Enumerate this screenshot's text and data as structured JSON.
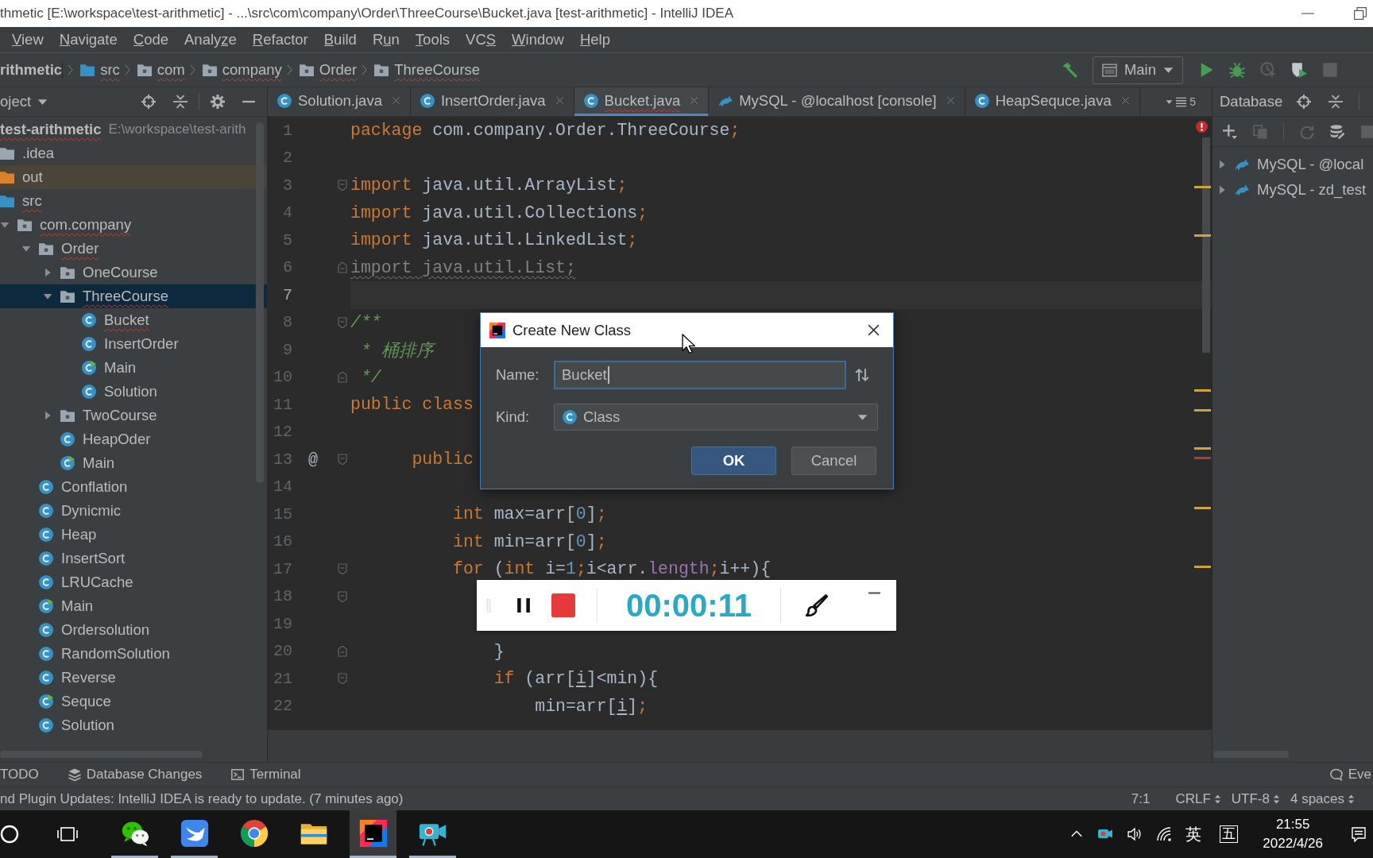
{
  "window": {
    "title": "thmetic [E:\\workspace\\test-arithmetic] - ...\\src\\com\\company\\Order\\ThreeCourse\\Bucket.java [test-arithmetic] - IntelliJ IDEA"
  },
  "menu": [
    {
      "label": "View",
      "mnemonic": {
        "kind": "first"
      }
    },
    {
      "label": "Navigate",
      "mnemonic": {
        "kind": "first"
      }
    },
    {
      "label": "Code",
      "mnemonic": {
        "kind": "first"
      }
    },
    {
      "label": "Analyze",
      "mnemonic": {
        "kind": "sixth"
      }
    },
    {
      "label": "Refactor",
      "mnemonic": {
        "kind": "first"
      }
    },
    {
      "label": "Build",
      "mnemonic": {
        "kind": "first"
      }
    },
    {
      "label": "Run",
      "mnemonic": {
        "kind": "second"
      }
    },
    {
      "label": "Tools",
      "mnemonic": {
        "kind": "first"
      }
    },
    {
      "label": "VCS",
      "mnemonic": {
        "kind": "third"
      }
    },
    {
      "label": "Window",
      "mnemonic": {
        "kind": "first"
      }
    },
    {
      "label": "Help",
      "mnemonic": {
        "kind": "first"
      }
    }
  ],
  "breadcrumbs": [
    {
      "label": "rithmetic",
      "kind": "project",
      "typo": false
    },
    {
      "label": "src",
      "kind": "source-folder",
      "typo": true
    },
    {
      "label": "com",
      "kind": "package",
      "typo": true
    },
    {
      "label": "company",
      "kind": "package",
      "typo": true
    },
    {
      "label": "Order",
      "kind": "package",
      "typo": true
    },
    {
      "label": "ThreeCourse",
      "kind": "package",
      "typo": true
    }
  ],
  "toolbar": [
    {
      "kind": "build",
      "disabled": false
    },
    {
      "kind": "config",
      "label": "Main"
    },
    {
      "kind": "run",
      "disabled": false
    },
    {
      "kind": "debug",
      "disabled": false
    },
    {
      "kind": "profile",
      "disabled": true
    },
    {
      "kind": "coverage",
      "disabled": false
    },
    {
      "kind": "stop",
      "disabled": true
    }
  ],
  "project_panel": {
    "title": "oject",
    "tree": [
      {
        "label": "test-arithmetic",
        "kind": "project",
        "path": "E:\\workspace\\test-arith",
        "typo": true,
        "selected": false,
        "children": [
          {
            "label": ".idea",
            "kind": "folder",
            "typo": false,
            "selected": false
          },
          {
            "label": "out",
            "kind": "excluded-folder",
            "typo": false,
            "selected": false
          },
          {
            "label": "src",
            "kind": "source-folder",
            "typo": true,
            "selected": false,
            "children": [
              {
                "label": "com.company",
                "kind": "package",
                "typo": true,
                "selected": false,
                "expanded": true,
                "children": [
                  {
                    "label": "Order",
                    "kind": "package",
                    "typo": true,
                    "selected": false,
                    "expanded": true,
                    "children": [
                      {
                        "label": "OneCourse",
                        "kind": "package",
                        "typo": false,
                        "selected": false,
                        "expanded": false
                      },
                      {
                        "label": "ThreeCourse",
                        "kind": "package",
                        "typo": true,
                        "selected": true,
                        "expanded": true,
                        "children": [
                          {
                            "label": "Bucket",
                            "kind": "class",
                            "typo": true,
                            "selected": false
                          },
                          {
                            "label": "InsertOrder",
                            "kind": "class",
                            "typo": false,
                            "selected": false
                          },
                          {
                            "label": "Main",
                            "kind": "runnable-class",
                            "typo": false,
                            "selected": false
                          },
                          {
                            "label": "Solution",
                            "kind": "class",
                            "typo": false,
                            "selected": false
                          }
                        ]
                      },
                      {
                        "label": "TwoCourse",
                        "kind": "package",
                        "typo": false,
                        "selected": false,
                        "expanded": false
                      },
                      {
                        "label": "HeapOder",
                        "kind": "class",
                        "typo": false,
                        "selected": false
                      },
                      {
                        "label": "Main",
                        "kind": "runnable-class",
                        "typo": false,
                        "selected": false
                      }
                    ]
                  },
                  {
                    "label": "Conflation",
                    "kind": "class",
                    "typo": false,
                    "selected": false
                  },
                  {
                    "label": "Dynicmic",
                    "kind": "class",
                    "typo": false,
                    "selected": false
                  },
                  {
                    "label": "Heap",
                    "kind": "class",
                    "typo": false,
                    "selected": false
                  },
                  {
                    "label": "InsertSort",
                    "kind": "class",
                    "typo": false,
                    "selected": false
                  },
                  {
                    "label": "LRUCache",
                    "kind": "class",
                    "typo": false,
                    "selected": false
                  },
                  {
                    "label": "Main",
                    "kind": "runnable-class",
                    "typo": false,
                    "selected": false
                  },
                  {
                    "label": "Ordersolution",
                    "kind": "class",
                    "typo": false,
                    "selected": false
                  },
                  {
                    "label": "RandomSolution",
                    "kind": "class",
                    "typo": false,
                    "selected": false
                  },
                  {
                    "label": "Reverse",
                    "kind": "class",
                    "typo": false,
                    "selected": false
                  },
                  {
                    "label": "Sequce",
                    "kind": "runnable-class",
                    "typo": false,
                    "selected": false
                  },
                  {
                    "label": "Solution",
                    "kind": "class",
                    "typo": false,
                    "selected": false
                  }
                ]
              }
            ]
          }
        ]
      }
    ]
  },
  "editor": {
    "tabs": [
      {
        "label": "Solution.java",
        "kind": "class",
        "selected": false,
        "error": false
      },
      {
        "label": "InsertOrder.java",
        "kind": "class",
        "selected": false,
        "error": false
      },
      {
        "label": "Bucket.java",
        "kind": "class",
        "selected": true,
        "error": true
      },
      {
        "label": "MySQL - @localhost [console]",
        "kind": "console",
        "selected": false,
        "error": false
      },
      {
        "label": "HeapSequce.java",
        "kind": "class",
        "selected": false,
        "error": false
      }
    ],
    "more_tabs": "5",
    "lines": [
      {
        "number": "1",
        "current": false,
        "tokens": [
          {
            "kind": "keyword",
            "text": "package"
          },
          {
            "kind": "plain",
            "text": " com.company.Order.ThreeCourse"
          },
          {
            "kind": "keyword",
            "text": ";"
          }
        ]
      },
      {
        "number": "2",
        "current": false
      },
      {
        "number": "3",
        "current": false,
        "fold": {
          "kind": "start"
        },
        "tokens": [
          {
            "kind": "keyword",
            "text": "import"
          },
          {
            "kind": "plain",
            "text": " java.util.ArrayList"
          },
          {
            "kind": "keyword",
            "text": ";"
          }
        ]
      },
      {
        "number": "4",
        "current": false,
        "tokens": [
          {
            "kind": "keyword",
            "text": "import"
          },
          {
            "kind": "plain",
            "text": " java.util.Collections"
          },
          {
            "kind": "keyword",
            "text": ";"
          }
        ]
      },
      {
        "number": "5",
        "current": false,
        "tokens": [
          {
            "kind": "keyword",
            "text": "import"
          },
          {
            "kind": "plain",
            "text": " java.util.LinkedList"
          },
          {
            "kind": "keyword",
            "text": ";"
          }
        ]
      },
      {
        "number": "6",
        "current": false,
        "fold": {
          "kind": "end"
        },
        "tokens": [
          {
            "kind": "unused",
            "text": "import java.util.List;"
          }
        ]
      },
      {
        "number": "7",
        "current": true
      },
      {
        "number": "8",
        "current": false,
        "fold": {
          "kind": "start"
        },
        "tokens": [
          {
            "kind": "doc",
            "text": "/**"
          }
        ]
      },
      {
        "number": "9",
        "current": false,
        "tokens": [
          {
            "kind": "doc",
            "text": " * 桶排序"
          }
        ]
      },
      {
        "number": "10",
        "current": false,
        "fold": {
          "kind": "end"
        },
        "tokens": [
          {
            "kind": "doc",
            "text": " */"
          }
        ]
      },
      {
        "number": "11",
        "current": false,
        "tokens": [
          {
            "kind": "keyword",
            "text": "public class"
          }
        ],
        "children": [
          {
            "number": "12",
            "current": false
          },
          {
            "number": "13",
            "current": false,
            "gutter": "@",
            "fold": {
              "kind": "start"
            },
            "tokens": [
              {
                "kind": "keyword",
                "text": "public"
              }
            ],
            "children": [
              {
                "number": "14",
                "current": false
              },
              {
                "number": "15",
                "current": false,
                "tokens": [
                  {
                    "kind": "keyword",
                    "text": "int"
                  },
                  {
                    "kind": "plain",
                    "text": " max=arr["
                  },
                  {
                    "kind": "number",
                    "text": "0"
                  },
                  {
                    "kind": "plain",
                    "text": "]"
                  },
                  {
                    "kind": "keyword",
                    "text": ";"
                  }
                ]
              },
              {
                "number": "16",
                "current": false,
                "tokens": [
                  {
                    "kind": "keyword",
                    "text": "int"
                  },
                  {
                    "kind": "plain",
                    "text": " min=arr["
                  },
                  {
                    "kind": "number",
                    "text": "0"
                  },
                  {
                    "kind": "plain",
                    "text": "]"
                  },
                  {
                    "kind": "keyword",
                    "text": ";"
                  }
                ]
              },
              {
                "number": "17",
                "current": false,
                "fold": {
                  "kind": "start"
                },
                "tokens": [
                  {
                    "kind": "keyword",
                    "text": "for"
                  },
                  {
                    "kind": "plain",
                    "text": " ("
                  },
                  {
                    "kind": "keyword",
                    "text": "int"
                  },
                  {
                    "kind": "plain",
                    "text": " i="
                  },
                  {
                    "kind": "number",
                    "text": "1"
                  },
                  {
                    "kind": "keyword",
                    "text": ";"
                  },
                  {
                    "kind": "plain",
                    "text": "i<arr."
                  },
                  {
                    "kind": "field",
                    "text": "length"
                  },
                  {
                    "kind": "keyword",
                    "text": ";"
                  },
                  {
                    "kind": "plain",
                    "text": "i++){"
                  }
                ],
                "children": [
                  {
                    "number": "18",
                    "current": false,
                    "fold": {
                      "kind": "start"
                    },
                    "children": [
                      {
                        "number": "19",
                        "current": false
                      }
                    ]
                  },
                  {
                    "number": "20",
                    "current": false,
                    "fold": {
                      "kind": "end"
                    },
                    "tokens": [
                      {
                        "kind": "plain",
                        "text": "}"
                      }
                    ]
                  },
                  {
                    "number": "21",
                    "current": false,
                    "fold": {
                      "kind": "start"
                    },
                    "tokens": [
                      {
                        "kind": "keyword",
                        "text": "if"
                      },
                      {
                        "kind": "plain",
                        "text": " (arr["
                      },
                      {
                        "kind": "reassigned",
                        "text": "i"
                      },
                      {
                        "kind": "plain",
                        "text": "]<min){"
                      }
                    ],
                    "children": [
                      {
                        "number": "22",
                        "current": false,
                        "tokens": [
                          {
                            "kind": "plain",
                            "text": "min=arr["
                          },
                          {
                            "kind": "reassigned",
                            "text": "i"
                          },
                          {
                            "kind": "plain",
                            "text": "]"
                          },
                          {
                            "kind": "keyword",
                            "text": ";"
                          }
                        ]
                      }
                    ]
                  }
                ]
              }
            ]
          }
        ]
      }
    ],
    "stripe_marks": [
      {
        "color": "#cfa23a"
      },
      {
        "color": "#cfa23a"
      },
      {
        "color": "#cfa23a"
      },
      {
        "color": "#cfa23a"
      },
      {
        "color": "#cfa23a"
      },
      {
        "color": "#b13b3b"
      },
      {
        "color": "#cfa23a"
      },
      {
        "color": "#cfa23a"
      }
    ]
  },
  "database_panel": {
    "title": "Database",
    "toolbar": [
      {
        "kind": "add",
        "disabled": false
      },
      {
        "kind": "copy",
        "disabled": true
      },
      {
        "kind": "refresh",
        "disabled": true
      },
      {
        "kind": "tool",
        "disabled": false
      },
      {
        "kind": "stop",
        "disabled": true
      }
    ],
    "items": [
      {
        "label": "MySQL - @local",
        "expanded": false
      },
      {
        "label": "MySQL - zd_test",
        "expanded": false
      }
    ]
  },
  "dialog": {
    "title": "Create New Class",
    "fields": [
      {
        "kind": "text",
        "label": "Name:",
        "value": "Bucket",
        "focused": true
      },
      {
        "kind": "dropdown",
        "label": "Kind:",
        "value": "Class"
      }
    ],
    "buttons": [
      {
        "label": "OK",
        "default": true
      },
      {
        "label": "Cancel",
        "default": false
      }
    ]
  },
  "recorder": {
    "time": "00:00:11"
  },
  "bottom_tools": {
    "tabs": [
      {
        "label": "TODO",
        "kind": "todo"
      },
      {
        "label": "Database Changes",
        "kind": "database-changes"
      },
      {
        "label": "Terminal",
        "kind": "terminal"
      }
    ],
    "event_log": "Eve"
  },
  "status_bar": {
    "message": "nd Plugin Updates: IntelliJ IDEA is ready to update. (7 minutes ago)",
    "position": "7:1",
    "widgets": [
      {
        "label": "CRLF"
      },
      {
        "label": "UTF-8"
      },
      {
        "label": "4 spaces"
      }
    ]
  },
  "taskbar": {
    "apps": [
      {
        "kind": "chat",
        "running": true,
        "selected": false
      },
      {
        "kind": "bird",
        "running": true,
        "selected": false
      },
      {
        "kind": "browser",
        "running": false,
        "selected": false
      },
      {
        "kind": "files",
        "running": false,
        "selected": false
      },
      {
        "kind": "ide",
        "running": true,
        "selected": true
      },
      {
        "kind": "recorder",
        "running": true,
        "selected": false
      }
    ],
    "tray": {
      "language": "英",
      "ime": "五",
      "time": "21:55",
      "date": "2022/4/26"
    }
  }
}
